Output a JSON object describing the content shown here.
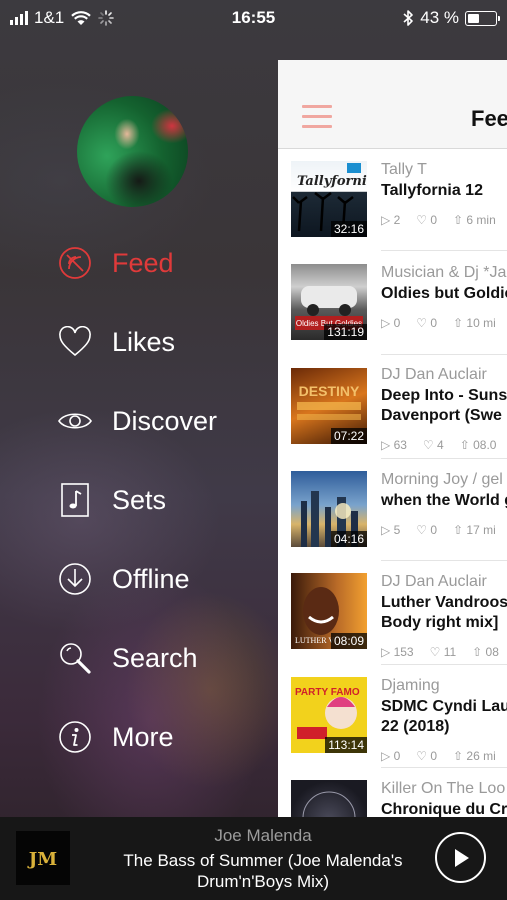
{
  "status_bar": {
    "carrier": "1&1",
    "time": "16:55",
    "battery": "43 %",
    "battery_level": 0.43,
    "icons": [
      "signal-icon",
      "wifi-icon",
      "loading-icon",
      "bluetooth-icon",
      "battery-icon"
    ]
  },
  "menu": {
    "items": [
      {
        "label": "Feed",
        "icon": "feed-icon",
        "active": true
      },
      {
        "label": "Likes",
        "icon": "heart-icon",
        "active": false
      },
      {
        "label": "Discover",
        "icon": "eye-icon",
        "active": false
      },
      {
        "label": "Sets",
        "icon": "music-note-icon",
        "active": false
      },
      {
        "label": "Offline",
        "icon": "download-icon",
        "active": false
      },
      {
        "label": "Search",
        "icon": "search-icon",
        "active": false
      },
      {
        "label": "More",
        "icon": "info-icon",
        "active": false
      }
    ],
    "active_color": "#e03a3a"
  },
  "feed": {
    "title": "Feed",
    "items": [
      {
        "subtitle": "Tally T",
        "title": "Tallyfornia 12",
        "title2": "",
        "duration": "32:16",
        "plays": "2",
        "likes": "0",
        "age": "6 min",
        "thumb_text": "Tallyfornia"
      },
      {
        "subtitle": "Musician & Dj  *Ja",
        "title": "Oldies but Goldie",
        "title2": "",
        "duration": "131:19",
        "plays": "0",
        "likes": "0",
        "age": "10 mi",
        "thumb_text": "Oldies But Goldies"
      },
      {
        "subtitle": "DJ Dan  Auclair",
        "title": "Deep Into -  Suns",
        "title2": "Davenport  (Swe",
        "duration": "07:22",
        "plays": "63",
        "likes": "4",
        "age": "08.0",
        "thumb_text": "DESTINY"
      },
      {
        "subtitle": "Morning Joy / gel",
        "title": "when the World g",
        "title2": "",
        "duration": "04:16",
        "plays": "5",
        "likes": "0",
        "age": "17 mi",
        "thumb_text": ""
      },
      {
        "subtitle": "DJ Dan  Auclair",
        "title": "Luther Vandroos",
        "title2": "Body right mix]",
        "duration": "08:09",
        "plays": "153",
        "likes": "11",
        "age": "08",
        "thumb_text": "LUTHER V"
      },
      {
        "subtitle": "Djaming",
        "title": "SDMC Cyndi Lau",
        "title2": "22 (2018)",
        "duration": "113:14",
        "plays": "0",
        "likes": "0",
        "age": "26 mi",
        "thumb_text": "PARTY FAMO"
      },
      {
        "subtitle": "Killer On The Loo",
        "title": "Chronique du Cr",
        "title2": "",
        "duration": "",
        "plays": "",
        "likes": "",
        "age": "",
        "thumb_text": ""
      }
    ]
  },
  "player": {
    "artist": "Joe Malenda",
    "track": "The Bass of Summer (Joe Malenda's Drum'n'Boys Mix)",
    "cover_text": "JM"
  }
}
